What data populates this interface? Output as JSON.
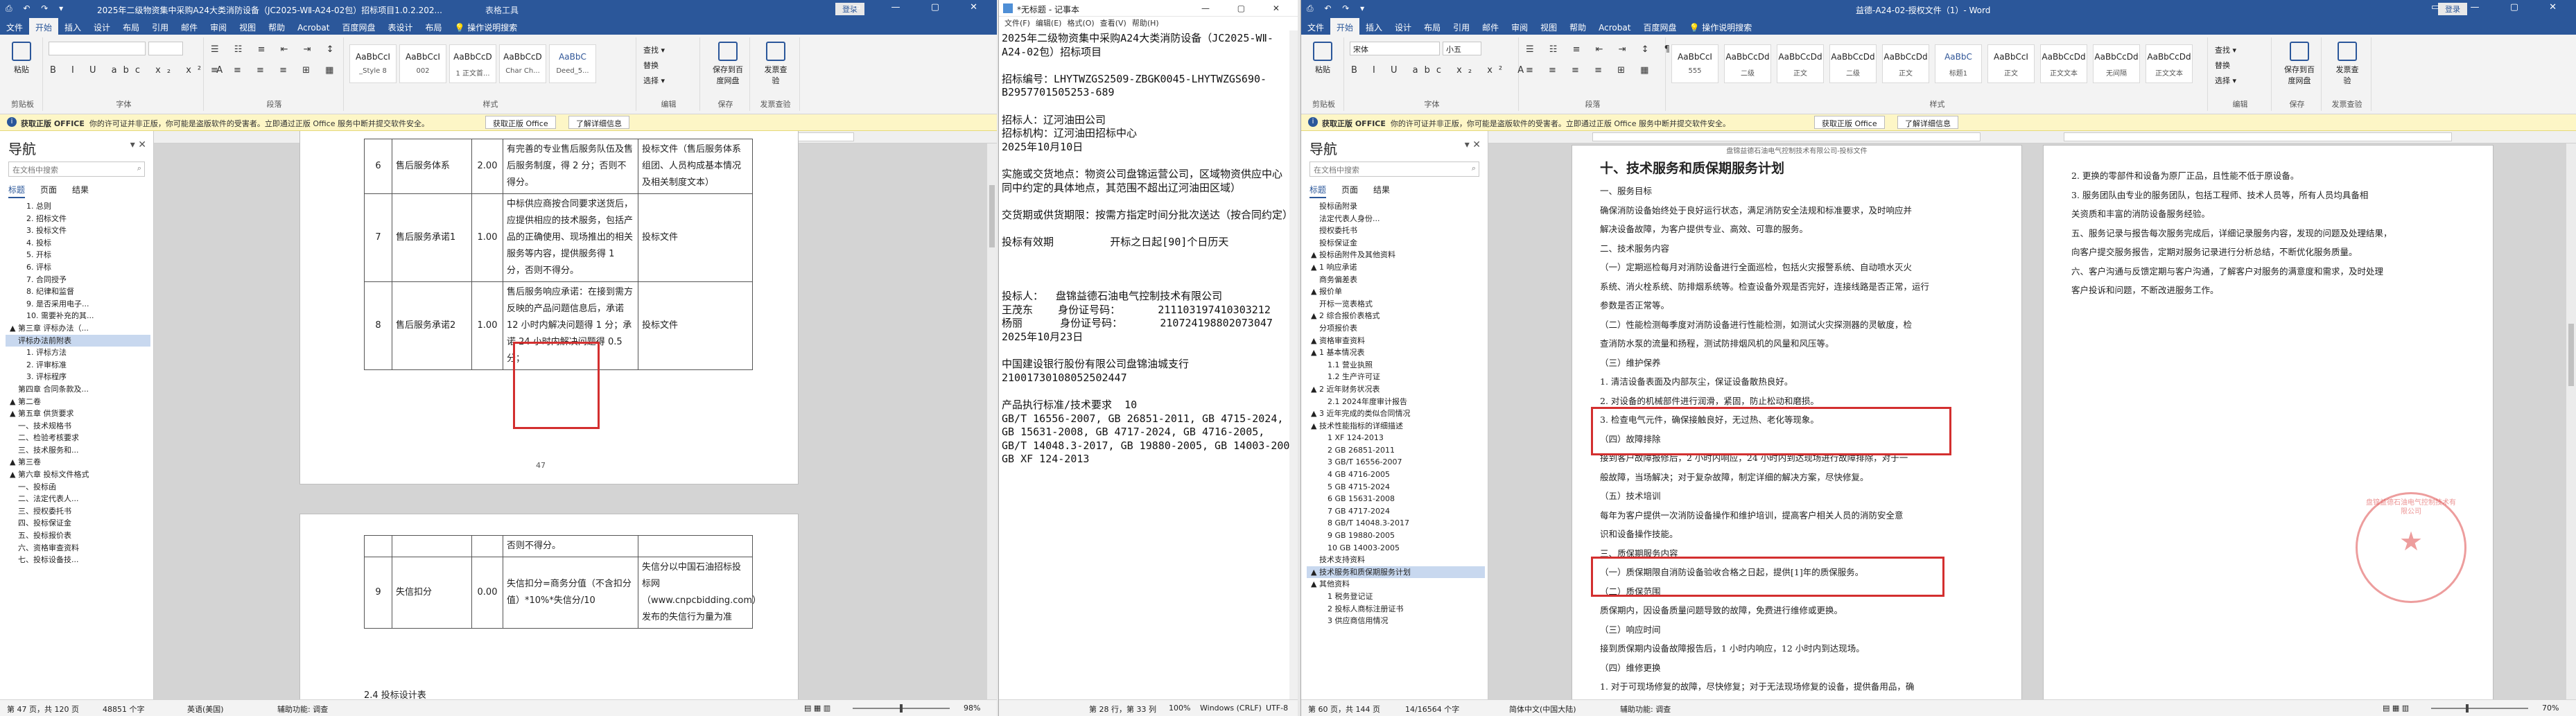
{
  "win1": {
    "qat": "⎙ ↶ ↷ ▾",
    "title": "2025年二级物资集中采购A24大类消防设备（JC2025-WⅡ-A24-02包）招标项目1.0.2.202...",
    "context_tab": "表格工具",
    "signin": "登录",
    "tabs": [
      "文件",
      "开始",
      "插入",
      "设计",
      "布局",
      "引用",
      "邮件",
      "审阅",
      "视图",
      "帮助",
      "Acrobat",
      "百度网盘",
      "表设计",
      "布局"
    ],
    "tell_me": "操作说明搜索",
    "ribbon": {
      "paste": "粘贴",
      "clipboard": "剪贴板",
      "font_name": "",
      "font_size": "",
      "font": "字体",
      "paragraph": "段落",
      "styles_label": "样式",
      "styles": [
        {
          "preview": "AaBbCcI",
          "name": "_Style 8"
        },
        {
          "preview": "AaBbCcI",
          "name": "002"
        },
        {
          "preview": "AaBbCcD",
          "name": "1 正文首..."
        },
        {
          "preview": "AaBbCcD",
          "name": "Char Ch..."
        },
        {
          "preview": "AaBbC",
          "name": "Deed_5..."
        }
      ],
      "edit_items": [
        "查找 ▾",
        "替换",
        "选择 ▾"
      ],
      "edit": "编辑",
      "save_baidu": "保存到百度网盘",
      "save": "保存",
      "invoice": "发票查验",
      "invoice_group": "发票查验"
    },
    "infobar": {
      "brand": "获取正版 OFFICE",
      "message": "你的许可证并非正版，你可能是盗版软件的受害者。立即通过正版 Office 服务中断并提交软件安全。",
      "btn1": "获取正版 Office",
      "btn2": "了解详细信息"
    },
    "nav": {
      "heading": "导航",
      "search_placeholder": "在文档中搜索",
      "tabs": [
        "标题",
        "页面",
        "结果"
      ],
      "items": [
        "1. 总则",
        "2. 招标文件",
        "3. 投标文件",
        "4. 投标",
        "5. 开标",
        "6. 评标",
        "7. 合同授予",
        "8. 纪律和监督",
        "9. 是否采用电子...",
        "10. 需要补充的其...",
        "▲ 第三章 评标办法（...",
        "评标办法前附表",
        "1. 评标方法",
        "2. 评审标准",
        "3. 评标程序",
        "第四章 合同条款及...",
        "▲ 第二卷",
        "▲ 第五章 供货要求",
        "一、技术规格书",
        "二、检验考核要求",
        "三、技术服务和...",
        "▲ 第三卷",
        "▲ 第六章 投标文件格式",
        "一、投标函",
        "二、法定代表人...",
        "三、授权委托书",
        "四、投标保证金",
        "五、投标报价表",
        "六、资格审查资料",
        "七、投标设备技..."
      ]
    },
    "table1": [
      {
        "no": "6",
        "item": "售后服务体系",
        "score": "2.00",
        "criteria": "有完善的专业售后服务队伍及售后服务制度，得 2 分；否则不得分。",
        "doc": "投标文件（售后服务体系组团、人员构成基本情况及相关制度文本）"
      },
      {
        "no": "7",
        "item": "售后服务承诺1",
        "score": "1.00",
        "criteria": "中标供应商按合同要求送货后，应提供相应的技术服务，包括产品的正确使用、现场推出的相关服务等内容，提供服务得 1 分，否则不得分。",
        "doc": "投标文件"
      },
      {
        "no": "8",
        "item": "售后服务承诺2",
        "score": "1.00",
        "criteria": "售后服务响应承诺：在接到需方反映的产品问题信息后，承诺 12 小时内解决问题得 1 分；承诺 24 小时内解决问题得 0.5 分；",
        "doc": "投标文件"
      }
    ],
    "page_num": "47",
    "table2": [
      {
        "no": "",
        "item": "",
        "score": "",
        "criteria": "否则不得分。",
        "doc": ""
      },
      {
        "no": "9",
        "item": "失信扣分",
        "score": "0.00",
        "criteria": "失信扣分=商务分值（不含扣分值）*10%*失信分/10",
        "doc": "失信分以中国石油招标投标网（www.cnpcbidding.com）发布的失信行为量为准"
      }
    ],
    "next_heading": "2.4 投标设计表",
    "status": {
      "page": "第 47 页，共 120 页",
      "words": "48851 个字",
      "lang": "英语(美国)",
      "assist": "辅助功能: 调查",
      "zoom": "98%"
    }
  },
  "win2": {
    "title": "*无标题 - 记事本",
    "menu": [
      "文件(F)",
      "编辑(E)",
      "格式(O)",
      "查看(V)",
      "帮助(H)"
    ],
    "lines": [
      "2025年二级物资集中采购A24大类消防设备（JC2025-WⅡ-",
      "A24-02包）招标项目",
      "",
      "招标编号：LHYTWZGS2509-ZBGK0045-LHYTWZGS690-",
      "B2957701505253-689",
      "",
      "招标人：辽河油田公司",
      "招标机构：辽河油田招标中心",
      "2025年10月10日",
      "",
      "实施或交货地点：物资公司盘锦运营公司，区域物资供应中心（合",
      "同中约定的具体地点，其范围不超出辽河油田区域）",
      "",
      "交货期或供货期限：按需方指定时间分批次送达（按合同约定）",
      "",
      "投标有效期         开标之日起[90]个日历天",
      "",
      "",
      "",
      "投标人：  盘锦益德石油电气控制技术有限公司",
      "王茂东    身份证号码：      211103197410303212",
      "杨丽      身份证号码：      210724198802073047",
      "2025年10月23日",
      "",
      "中国建设银行股份有限公司盘锦油城支行",
      "21001730108052502447",
      "",
      "产品执行标准/技术要求  10",
      "GB/T 16556-2007, GB 26851-2011, GB 4715-2024,",
      "GB 15631-2008, GB 4717-2024, GB 4716-2005,",
      "GB/T 14048.3-2017, GB 19880-2005, GB 14003-2005,",
      "GB XF 124-2013"
    ],
    "status": {
      "pos": "第 28 行，第 33 列",
      "zoom": "100%",
      "eol": "Windows (CRLF)",
      "enc": "UTF-8"
    }
  },
  "win3": {
    "qat": "⎙ ↶ ↷ ▾",
    "title": "益德-A24-02-授权文件（1）- Word",
    "signin": "登录",
    "tabs": [
      "文件",
      "开始",
      "插入",
      "设计",
      "布局",
      "引用",
      "邮件",
      "审阅",
      "视图",
      "帮助",
      "Acrobat",
      "百度网盘"
    ],
    "tell_me": "操作说明搜索",
    "ribbon": {
      "paste": "粘贴",
      "clipboard": "剪贴板",
      "font_name": "宋体",
      "font_size": "小五",
      "font": "字体",
      "paragraph": "段落",
      "styles_label": "样式",
      "styles": [
        {
          "preview": "AaBbCcI",
          "name": "555"
        },
        {
          "preview": "AaBbCcDd",
          "name": "二级"
        },
        {
          "preview": "AaBbCcDd",
          "name": "正文"
        },
        {
          "preview": "AaBbCcDd",
          "name": "二级"
        },
        {
          "preview": "AaBbCcDd",
          "name": "正文"
        },
        {
          "preview": "AaBbC",
          "name": "标题1"
        },
        {
          "preview": "AaBbCcI",
          "name": "正文"
        },
        {
          "preview": "AaBbCcDd",
          "name": "正文文本"
        },
        {
          "preview": "AaBbCcDd",
          "name": "无间隔"
        },
        {
          "preview": "AaBbCcDd",
          "name": "正文文本"
        }
      ],
      "edit_items": [
        "查找 ▾",
        "替换",
        "选择 ▾"
      ],
      "edit": "编辑",
      "save_baidu": "保存到百度网盘",
      "save": "保存",
      "invoice": "发票查验",
      "invoice_group": "发票查验"
    },
    "infobar": {
      "brand": "获取正版 OFFICE",
      "message": "你的许可证并非正版，你可能是盗版软件的受害者。立即通过正版 Office 服务中断并提交软件安全。",
      "btn1": "获取正版 Office",
      "btn2": "了解详细信息"
    },
    "nav": {
      "heading": "导航",
      "search_placeholder": "在文档中搜索",
      "tabs": [
        "标题",
        "页面",
        "结果"
      ],
      "items": [
        "投标函附录",
        "法定代表人身份...",
        "授权委托书",
        "投标保证金",
        "▲ 投标函附件及其他资料",
        "▲ 1 响应承诺",
        "商务偏差表",
        "▲ 报价单",
        "开标一览表格式",
        "▲ 2 综合报价表格式",
        "分项报价表",
        "▲ 资格审查资料",
        "▲ 1 基本情况表",
        "1.1 营业执照",
        "1.2 生产许可证",
        "▲ 2 近年财务状况表",
        "2.1 2024年度审计报告",
        "▲ 3 近年完成的类似合同情况",
        "▲ 技术性能指标的详细描述",
        "1 XF 124-2013",
        "2 GB 26851-2011",
        "3 GB/T 16556-2007",
        "4 GB 4716-2005",
        "5 GB 4715-2024",
        "6 GB 15631-2008",
        "7 GB 4717-2024",
        "8 GB/T 14048.3-2017",
        "9 GB 19880-2005",
        "10 GB 14003-2005",
        "技术支持资料",
        "▲ 技术服务和质保期服务计划",
        "▲ 其他资料",
        "1 税务登记证",
        "2 投标人商标注册证书",
        "3 供应商信用情况"
      ],
      "selected_index": 30
    },
    "left_page": {
      "header": "盘锦益德石油电气控制技术有限公司-投标文件",
      "heading": "十、技术服务和质保期服务计划",
      "paras": [
        "一、服务目标",
        "确保消防设备始终处于良好运行状态，满足消防安全法规和标准要求，及时响应并",
        "解决设备故障，为客户提供专业、高效、可靠的服务。",
        "二、技术服务内容",
        "（一）定期巡检每月对消防设备进行全面巡检，包括火灾报警系统、自动喷水灭火",
        "系统、消火栓系统、防排烟系统等。检查设备外观是否完好，连接线路是否正常，运行",
        "参数是否正常等。",
        "（二）性能检测每季度对消防设备进行性能检测，如测试火灾探测器的灵敏度，检",
        "查消防水泵的流量和扬程，测试防排烟风机的风量和风压等。",
        "（三）维护保养",
        "1. 清洁设备表面及内部灰尘，保证设备散热良好。",
        "2. 对设备的机械部件进行润滑，紧固，防止松动和磨损。",
        "3. 检查电气元件，确保接触良好，无过热、老化等现象。",
        "（四）故障排除",
        "接到客户故障报修后，2 小时内响应，24 小时内到达现场进行故障排除，对于一",
        "般故障，当场解决；对于复杂故障，制定详细的解决方案，尽快修复。",
        "（五）技术培训",
        "每年为客户提供一次消防设备操作和维护培训，提高客户相关人员的消防安全意",
        "识和设备操作技能。",
        "三、质保期服务内容",
        "（一）质保期限自消防设备验收合格之日起，提供[1]年的质保服务。",
        "（二）质保范围",
        "质保期内，因设备质量问题导致的故障，免费进行维修或更换。",
        "（三）响应时间",
        "接到质保期内设备故障报告后，1 小时内响应，12 小时内到达现场。",
        "（四）维修更换",
        "1. 对于可现场修复的故障，尽快修复；对于无法现场修复的设备，提供备用品，确",
        "保消防系统正常运行。"
      ]
    },
    "right_page": {
      "paras": [
        "2. 更换的零部件和设备为原厂正品，且性能不低于原设备。",
        "3. 服务团队由专业的服务团队，包括工程师、技术人员等，所有人员均具备相",
        "关资质和丰富的消防设备服务经验。",
        "五、服务记录与报告每次服务完成后，详细记录服务内容，发现的问题及处理结果，",
        "向客户提交服务报告，定期对服务记录进行分析总结，不断优化服务质量。",
        "六、客户沟通与反馈定期与客户沟通，了解客户对服务的满意度和需求，及时处理",
        "客户投诉和问题，不断改进服务工作。"
      ],
      "seal_text": "盘锦益德石油电气控制技术有限公司"
    },
    "status": {
      "page": "第 60 页，共 144 页",
      "words": "14/16564 个字",
      "lang": "简体中文(中国大陆)",
      "assist": "辅助功能: 调查",
      "zoom": "70%"
    }
  }
}
